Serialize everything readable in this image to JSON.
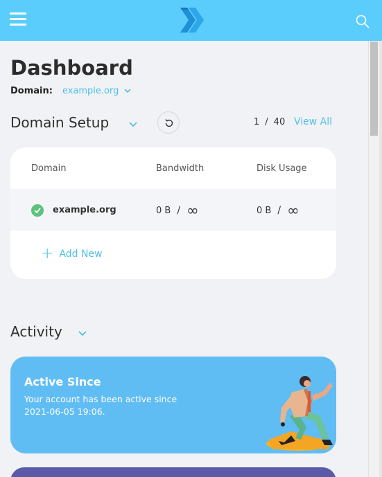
{
  "topbar": {
    "menu_icon": "hamburger-icon",
    "logo_icon": "chevron-logo-icon",
    "search_icon": "search-icon",
    "color": "#5bcdfd"
  },
  "page": {
    "title": "Dashboard",
    "domain_label": "Domain:",
    "domain_value": "example.org"
  },
  "domain_setup": {
    "title": "Domain Setup",
    "pager_current": "1",
    "pager_separator": "/",
    "pager_total": "40",
    "view_all": "View All",
    "columns": [
      "Domain",
      "Bandwidth",
      "Disk Usage"
    ],
    "rows": [
      {
        "domain": "example.org",
        "bandwidth_used": "0 B",
        "bandwidth_limit": "∞",
        "disk_used": "0 B",
        "disk_limit": "∞",
        "status": "active"
      }
    ],
    "add_new": "Add New"
  },
  "activity": {
    "title": "Activity",
    "active_since": {
      "title": "Active Since",
      "text": "Your account has been active since 2021-06-05 19:06."
    }
  },
  "colors": {
    "accent": "#4fbfe8",
    "success": "#5cc27c",
    "card_blue": "#60bdf4",
    "card_purple": "#5a5aa8"
  }
}
